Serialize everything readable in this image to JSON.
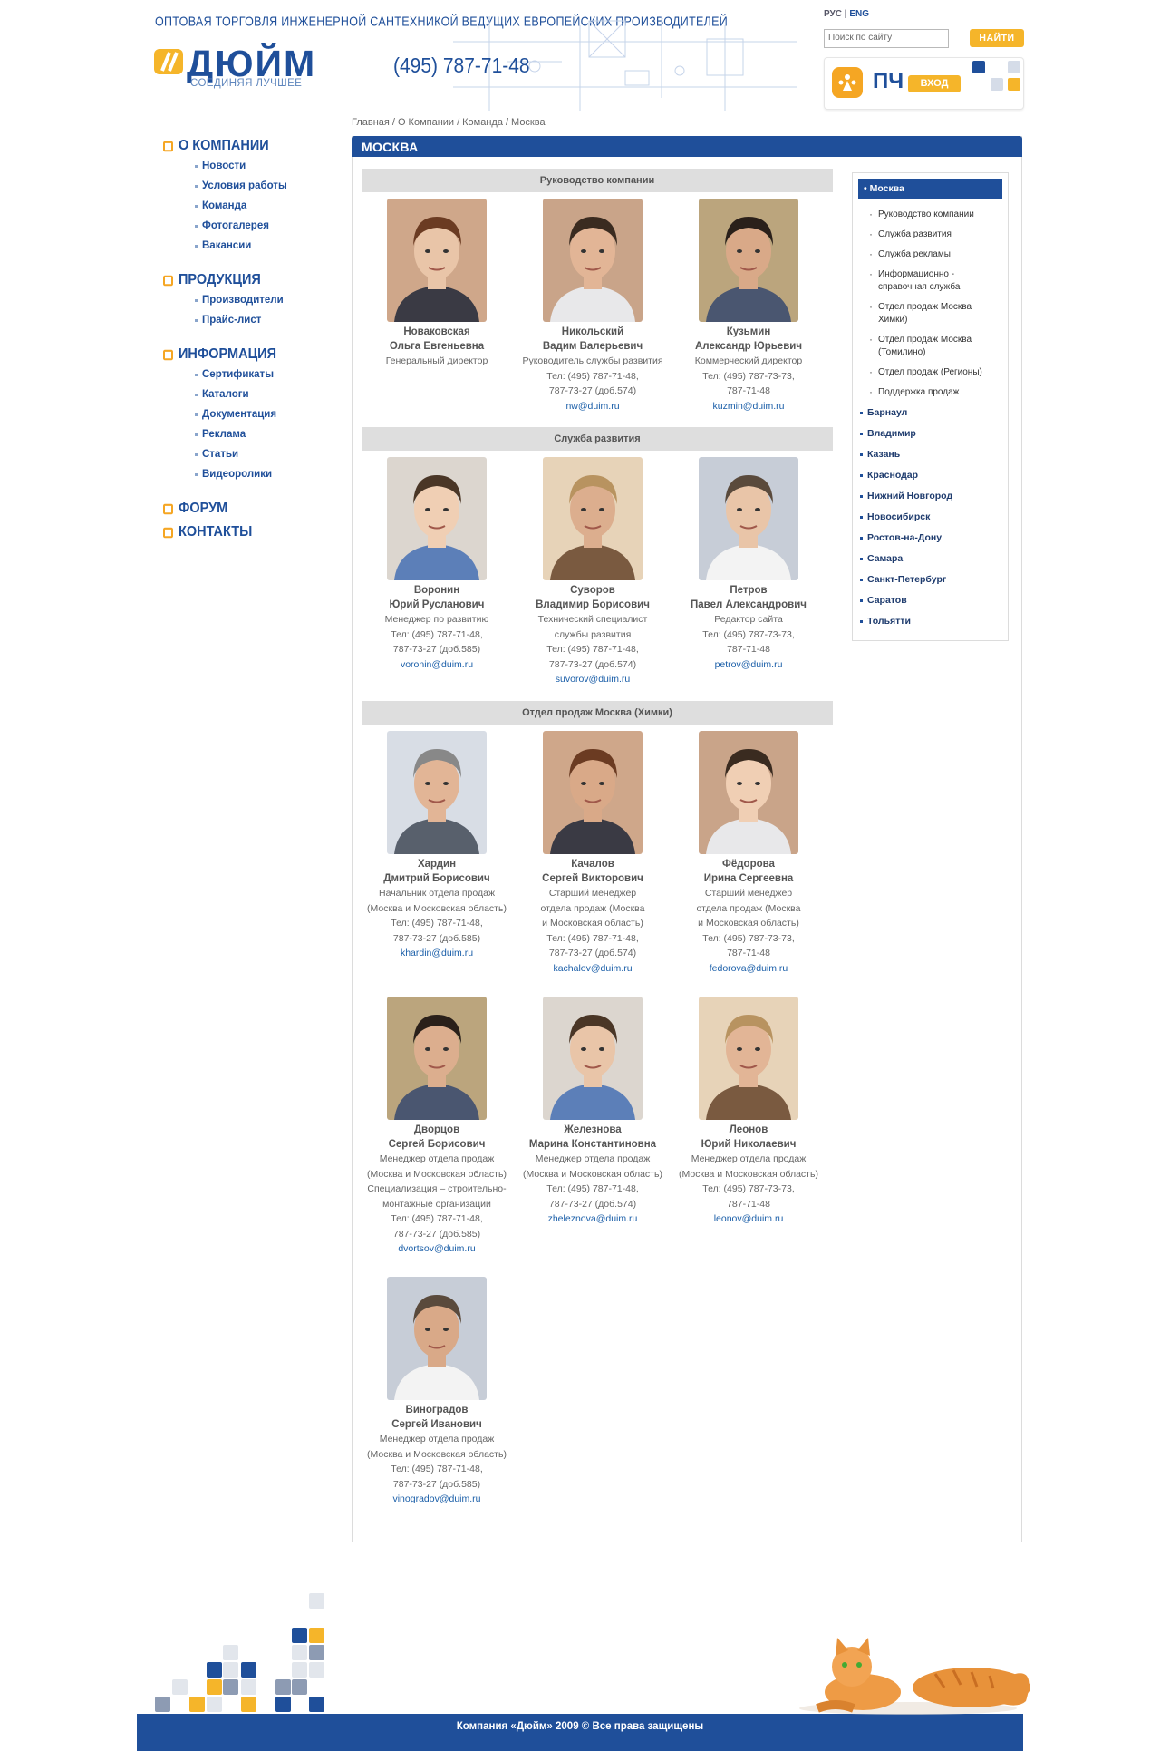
{
  "header": {
    "tagline": "ОПТОВАЯ ТОРГОВЛЯ ИНЖЕНЕРНОЙ САНТЕХНИКОЙ ВЕДУЩИХ ЕВРОПЕЙСКИХ ПРОИЗВОДИТЕЛЕЙ",
    "logo_text": "ДЮЙМ",
    "logo_slogan": "СОЕДИНЯЯ ЛУЧШЕЕ",
    "phone": "(495) 787-71-48",
    "lang_ru": "РУС",
    "lang_sep": "|",
    "lang_en": "ENG",
    "search_placeholder": "Поиск по сайту",
    "search_button": "НАЙТИ",
    "login_brand": "ПЧ",
    "login_button": "ВХОД"
  },
  "breadcrumb": [
    "Главная",
    "О Компании",
    "Команда",
    "Москва"
  ],
  "breadcrumb_sep": "/",
  "leftnav": [
    {
      "title": "О КОМПАНИИ",
      "items": [
        "Новости",
        "Условия работы",
        "Команда",
        "Фотогалерея",
        "Вакансии"
      ]
    },
    {
      "title": "ПРОДУКЦИЯ",
      "items": [
        "Производители",
        "Прайс-лист"
      ]
    },
    {
      "title": "ИНФОРМАЦИЯ",
      "items": [
        "Сертификаты",
        "Каталоги",
        "Документация",
        "Реклама",
        "Статьи",
        "Видеоролики"
      ]
    },
    {
      "title": "ФОРУМ",
      "items": []
    },
    {
      "title": "КОНТАКТЫ",
      "items": []
    }
  ],
  "main": {
    "title": "МОСКВА",
    "departments": [
      {
        "name": "Руководство компании",
        "people": [
          {
            "surname": "Новаковская",
            "name": "Ольга Евгеньевна",
            "lines": [
              "Генеральный директор"
            ],
            "email": ""
          },
          {
            "surname": "Никольский",
            "name": "Вадим Валерьевич",
            "lines": [
              "Руководитель службы развития",
              "Тел: (495) 787-71-48,",
              "787-73-27 (доб.574)"
            ],
            "email": "nw@duim.ru"
          },
          {
            "surname": "Кузьмин",
            "name": "Александр Юрьевич",
            "lines": [
              "Коммерческий директор",
              "Тел: (495) 787-73-73,",
              "787-71-48"
            ],
            "email": "kuzmin@duim.ru"
          }
        ]
      },
      {
        "name": "Служба развития",
        "people": [
          {
            "surname": "Воронин",
            "name": "Юрий Русланович",
            "lines": [
              "Менеджер по развитию",
              "Тел: (495) 787-71-48,",
              "787-73-27 (доб.585)"
            ],
            "email": "voronin@duim.ru"
          },
          {
            "surname": "Суворов",
            "name": "Владимир Борисович",
            "lines": [
              "Технический специалист",
              "службы развития",
              "Тел: (495) 787-71-48,",
              "787-73-27 (доб.574)"
            ],
            "email": "suvorov@duim.ru"
          },
          {
            "surname": "Петров",
            "name": "Павел Александрович",
            "lines": [
              "Редактор сайта",
              "Тел: (495) 787-73-73,",
              "787-71-48"
            ],
            "email": "petrov@duim.ru"
          }
        ]
      },
      {
        "name": "Отдел продаж Москва (Химки)",
        "people": [
          {
            "surname": "Хардин",
            "name": "Дмитрий Борисович",
            "lines": [
              "Начальник отдела продаж",
              "(Москва и Московская область)",
              "Тел: (495) 787-71-48,",
              "787-73-27 (доб.585)"
            ],
            "email": "khardin@duim.ru"
          },
          {
            "surname": "Качалов",
            "name": "Сергей Викторович",
            "lines": [
              "Старший менеджер",
              "отдела продаж (Москва",
              "и Московская область)",
              "Тел: (495) 787-71-48,",
              "787-73-27 (доб.574)"
            ],
            "email": "kachalov@duim.ru"
          },
          {
            "surname": "Фёдорова",
            "name": "Ирина Сергеевна",
            "lines": [
              "Старший менеджер",
              "отдела продаж (Москва",
              "и Московская область)",
              "Тел: (495) 787-73-73,",
              "787-71-48"
            ],
            "email": "fedorova@duim.ru"
          },
          {
            "surname": "Дворцов",
            "name": "Сергей Борисович",
            "lines": [
              "Менеджер отдела продаж",
              "(Москва и Московская область)",
              "Специализация – строительно-",
              "монтажные организации",
              "Тел: (495) 787-71-48,",
              "787-73-27 (доб.585)"
            ],
            "email": "dvortsov@duim.ru"
          },
          {
            "surname": "Железнова",
            "name": "Марина Константиновна",
            "lines": [
              "Менеджер отдела продаж",
              "(Москва и Московская область)",
              "Тел: (495) 787-71-48,",
              "787-73-27 (доб.574)"
            ],
            "email": "zheleznova@duim.ru"
          },
          {
            "surname": "Леонов",
            "name": "Юрий Николаевич",
            "lines": [
              "Менеджер отдела продаж",
              "(Москва и Московская область)",
              "Тел: (495) 787-73-73,",
              "787-71-48"
            ],
            "email": "leonov@duim.ru"
          },
          {
            "surname": "Виноградов",
            "name": "Сергей Иванович",
            "lines": [
              "Менеджер отдела продаж",
              "(Москва и Московская область)",
              "Тел: (495) 787-71-48,",
              "787-73-27 (доб.585)"
            ],
            "email": "vinogradov@duim.ru"
          }
        ]
      }
    ]
  },
  "subnav": {
    "active": "Москва",
    "sub_items": [
      "Руководство компании",
      "Служба развития",
      "Служба рекламы",
      "Информационно - справочная служба",
      "Отдел продаж Москва Химки)",
      "Отдел продаж Москва (Томилино)",
      "Отдел продаж (Регионы)",
      "Поддержка продаж"
    ],
    "cities": [
      "Барнаул",
      "Владимир",
      "Казань",
      "Краснодар",
      "Нижний Новгород",
      "Новосибирск",
      "Ростов-на-Дону",
      "Самара",
      "Санкт-Петербург",
      "Саратов",
      "Тольятти"
    ]
  },
  "footer": {
    "copyright": "Компания «Дюйм» 2009 © Все права защищены"
  },
  "colors": {
    "brand_blue": "#1f4f9a",
    "accent_orange": "#f5b52a",
    "dept_header_gray": "#dedede"
  }
}
